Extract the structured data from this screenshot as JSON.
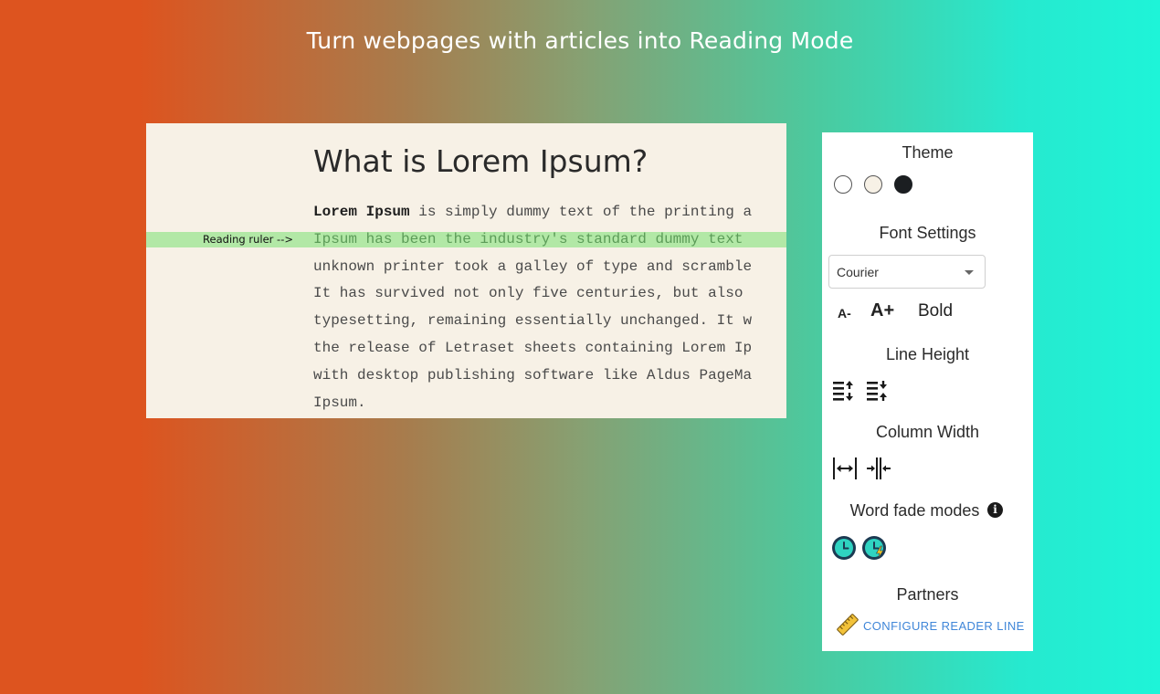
{
  "headline": "Turn webpages with articles into Reading Mode",
  "article": {
    "title": "What is Lorem Ipsum?",
    "ruler_label": "Reading ruler -->",
    "lines": [
      {
        "bold": "Lorem Ipsum",
        "text": " is simply dummy text of the printing a"
      },
      {
        "bold": "",
        "text": "Ipsum has been the industry's standard dummy text"
      },
      {
        "bold": "",
        "text": "unknown printer took a galley of type and scramble"
      },
      {
        "bold": "",
        "text": "It has survived not only five centuries, but also"
      },
      {
        "bold": "",
        "text": "typesetting, remaining essentially unchanged. It w"
      },
      {
        "bold": "",
        "text": "the release of Letraset sheets containing Lorem Ip"
      },
      {
        "bold": "",
        "text": "with desktop publishing software like Aldus PageMa"
      },
      {
        "bold": "",
        "text": "Ipsum."
      }
    ]
  },
  "panel": {
    "theme": {
      "title": "Theme",
      "swatches": [
        {
          "name": "light",
          "color": "#ffffff"
        },
        {
          "name": "sepia",
          "color": "#f7f1e6"
        },
        {
          "name": "dark",
          "color": "#1b1e21"
        }
      ]
    },
    "font_settings": {
      "title": "Font Settings",
      "selected_font": "Courier",
      "decrease_label": "A-",
      "increase_label": "A+",
      "bold_label": "Bold"
    },
    "line_height": {
      "title": "Line Height"
    },
    "column_width": {
      "title": "Column Width"
    },
    "word_fade": {
      "title": "Word fade modes"
    },
    "partners": {
      "title": "Partners",
      "link_label": "CONFIGURE READER LINE"
    }
  },
  "colors": {
    "ruler_band": "#b2e8a6",
    "link": "#3f86d8",
    "fade_teal": "#2fd3c1",
    "fade_ring": "#1c3a52"
  }
}
